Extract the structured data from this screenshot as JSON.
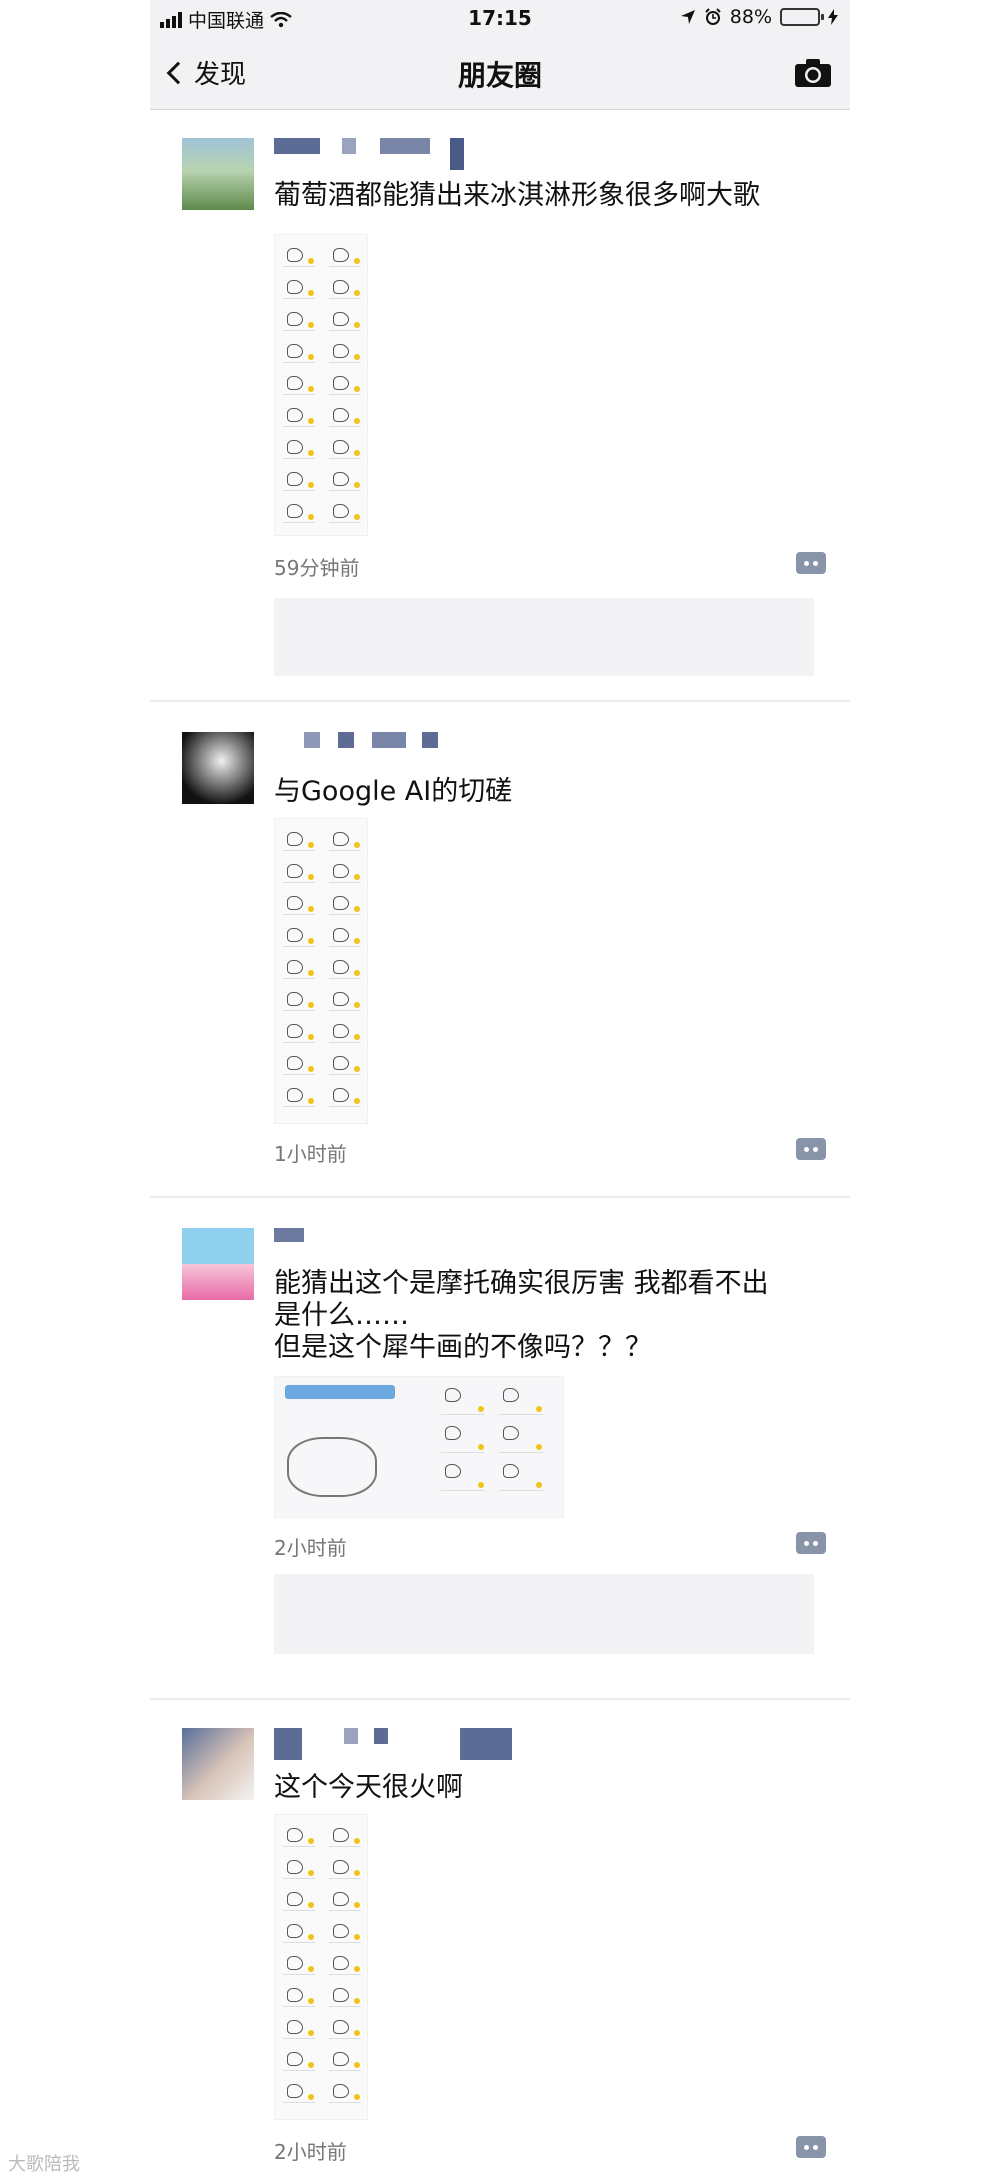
{
  "status_bar": {
    "carrier": "中国联通",
    "time": "17:15",
    "battery": "88%",
    "battery_level": 0.88
  },
  "nav": {
    "back_label": "发现",
    "title": "朋友圈"
  },
  "posts": [
    {
      "text": "葡萄酒都能猜出来冰淇淋形象很多啊大歌",
      "time": "59分钟前"
    },
    {
      "text": "与Google AI的切磋",
      "time": "1小时前"
    },
    {
      "text": "能猜出这个是摩托确实很厉害 我都看不出\n是什么……\n但是这个犀牛画的不像吗？？？",
      "time": "2小时前"
    },
    {
      "text": "这个今天很火啊",
      "time": "2小时前"
    }
  ],
  "watermark": "大歌陪我"
}
